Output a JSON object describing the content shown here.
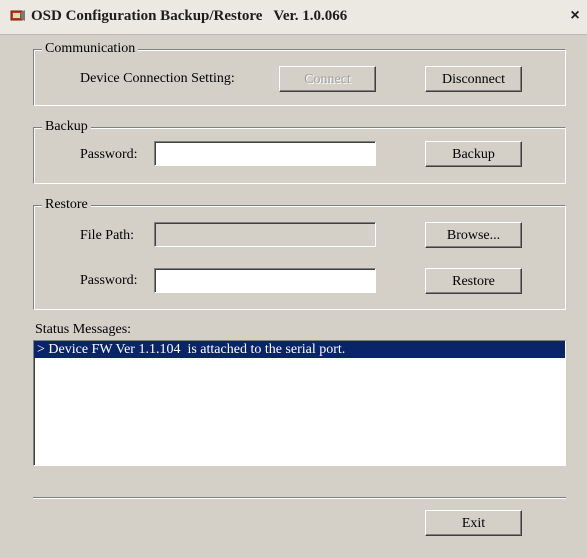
{
  "window": {
    "title": "OSD Configuration Backup/Restore   Ver. 1.0.066",
    "close_glyph": "×"
  },
  "communication": {
    "legend": "Communication",
    "device_label": "Device Connection Setting:",
    "connect_label": "Connect",
    "disconnect_label": "Disconnect"
  },
  "backup": {
    "legend": "Backup",
    "password_label": "Password:",
    "password_value": "",
    "backup_label": "Backup"
  },
  "restore": {
    "legend": "Restore",
    "file_path_label": "File Path:",
    "file_path_value": "",
    "browse_label": "Browse...",
    "password_label": "Password:",
    "password_value": "",
    "restore_label": "Restore"
  },
  "status": {
    "label": "Status Messages:",
    "messages": [
      "> Device FW Ver 1.1.104  is attached to the serial port."
    ]
  },
  "footer": {
    "exit_label": "Exit"
  }
}
